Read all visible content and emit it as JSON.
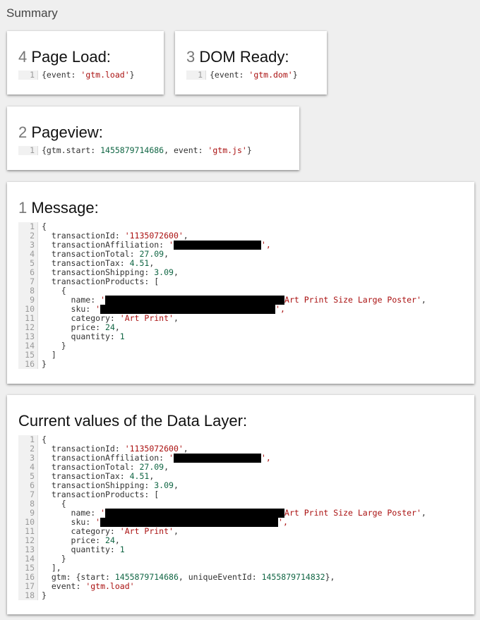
{
  "summary_label": "Summary",
  "cards": {
    "page_load": {
      "num": "4",
      "label": "Page Load:",
      "line_num": "1",
      "code": {
        "pre": "{event: ",
        "str": "'gtm.load'",
        "post": "}"
      }
    },
    "dom_ready": {
      "num": "3",
      "label": "DOM Ready:",
      "line_num": "1",
      "code": {
        "pre": "{event: ",
        "str": "'gtm.dom'",
        "post": "}"
      }
    },
    "pageview": {
      "num": "2",
      "label": "Pageview:",
      "line_num": "1",
      "code": {
        "pre": "{gtm.start: ",
        "start": "1455879714686",
        "mid": ", event: ",
        "str": "'gtm.js'",
        "post": "}"
      }
    },
    "message": {
      "num": "1",
      "label": "Message:",
      "line_nums": [
        "1",
        "2",
        "3",
        "4",
        "5",
        "6",
        "7",
        "8",
        "9",
        "10",
        "11",
        "12",
        "13",
        "14",
        "15",
        "16"
      ],
      "code": {
        "open": "{",
        "k_id": "  transactionId: ",
        "v_id": "'1135072600'",
        "c1": ",",
        "k_aff": "  transactionAffiliation: ",
        "q_open": "'",
        "q_close": "',",
        "k_total": "  transactionTotal: ",
        "v_total": "27.09",
        "c2": ",",
        "k_tax": "  transactionTax: ",
        "v_tax": "4.51",
        "c3": ",",
        "k_ship": "  transactionShipping: ",
        "v_ship": "3.09",
        "c4": ",",
        "k_prod": "  transactionProducts: [",
        "obj_open": "    {",
        "k_name": "      name: ",
        "name_tail": "Art Print Size Large Poster'",
        "c5": ",",
        "k_sku": "      sku: ",
        "sku_q": "'",
        "sku_close": "',",
        "k_cat": "      category: ",
        "v_cat": "'Art Print'",
        "c6": ",",
        "k_price": "      price: ",
        "v_price": "24",
        "c7": ",",
        "k_qty": "      quantity: ",
        "v_qty": "1",
        "obj_close": "    }",
        "arr_close": "  ]",
        "close": "}"
      }
    },
    "data_layer": {
      "label": "Current values of the Data Layer:",
      "line_nums": [
        "1",
        "2",
        "3",
        "4",
        "5",
        "6",
        "7",
        "8",
        "9",
        "10",
        "11",
        "12",
        "13",
        "14",
        "15",
        "16",
        "17",
        "18"
      ],
      "code": {
        "open": "{",
        "k_id": "  transactionId: ",
        "v_id": "'1135072600'",
        "c1": ",",
        "k_aff": "  transactionAffiliation: ",
        "q_open": "'",
        "q_close": "',",
        "k_total": "  transactionTotal: ",
        "v_total": "27.09",
        "c2": ",",
        "k_tax": "  transactionTax: ",
        "v_tax": "4.51",
        "c3": ",",
        "k_ship": "  transactionShipping: ",
        "v_ship": "3.09",
        "c4": ",",
        "k_prod": "  transactionProducts: [",
        "obj_open": "    {",
        "k_name": "      name: ",
        "name_tail": "Art Print Size Large Poster'",
        "c5": ",",
        "k_sku": "      sku: ",
        "sku_q": "'",
        "sku_close": "',",
        "k_cat": "      category: ",
        "v_cat": "'Art Print'",
        "c6": ",",
        "k_price": "      price: ",
        "v_price": "24",
        "c7": ",",
        "k_qty": "      quantity: ",
        "v_qty": "1",
        "obj_close": "    }",
        "arr_close": "  ],",
        "k_gtm": "  gtm: {start: ",
        "v_start": "1455879714686",
        "k_uid": ", uniqueEventId: ",
        "v_uid": "1455879714832",
        "gtm_close": "},",
        "k_event": "  event: ",
        "v_event": "'gtm.load'",
        "close": "}"
      }
    }
  }
}
